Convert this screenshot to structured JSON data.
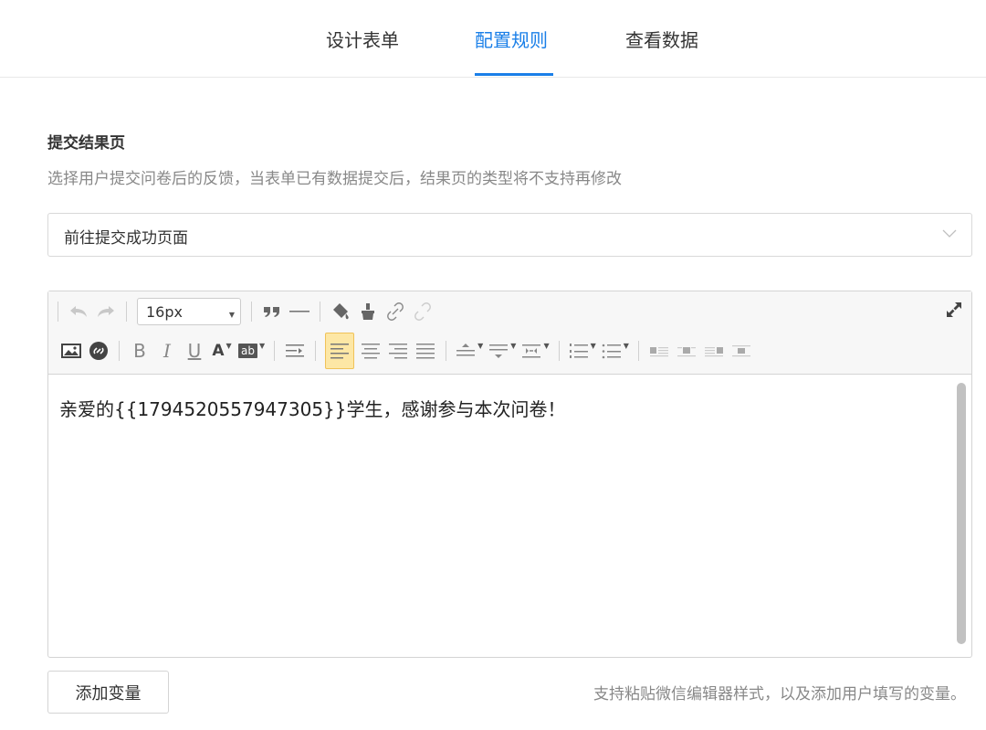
{
  "tabs": [
    {
      "label": "设计表单",
      "active": false
    },
    {
      "label": "配置规则",
      "active": true
    },
    {
      "label": "查看数据",
      "active": false
    }
  ],
  "section": {
    "title": "提交结果页",
    "description": "选择用户提交问卷后的反馈，当表单已有数据提交后，结果页的类型将不支持再修改"
  },
  "result_select": {
    "value": "前往提交成功页面"
  },
  "editor": {
    "font_size": "16px",
    "content": "亲爱的{{1794520557947305}}学生，感谢参与本次问卷！",
    "toolbar_icons": [
      "undo-icon",
      "redo-icon",
      "quote-icon",
      "horizontal-rule-icon",
      "format-painter-icon",
      "clear-format-icon",
      "link-icon",
      "unlink-icon",
      "expand-icon",
      "image-icon",
      "embed-icon",
      "bold-icon",
      "italic-icon",
      "underline-icon",
      "font-color-icon",
      "background-color-icon",
      "indent-icon",
      "align-left-icon",
      "align-center-icon",
      "align-right-icon",
      "align-justify-icon",
      "line-height-icon",
      "paragraph-spacing-icon",
      "letter-spacing-icon",
      "ordered-list-icon",
      "unordered-list-icon",
      "image-float-icon"
    ],
    "toolbar_labels": {
      "bold": "B",
      "italic": "I",
      "underline": "U",
      "font_color": "A",
      "bg_color": "ab"
    }
  },
  "footer": {
    "add_variable_label": "添加变量",
    "hint": "支持粘贴微信编辑器样式，以及添加用户填写的变量。"
  },
  "colors": {
    "accent": "#1a7fe8",
    "active_format_bg": "#fde7a5"
  }
}
